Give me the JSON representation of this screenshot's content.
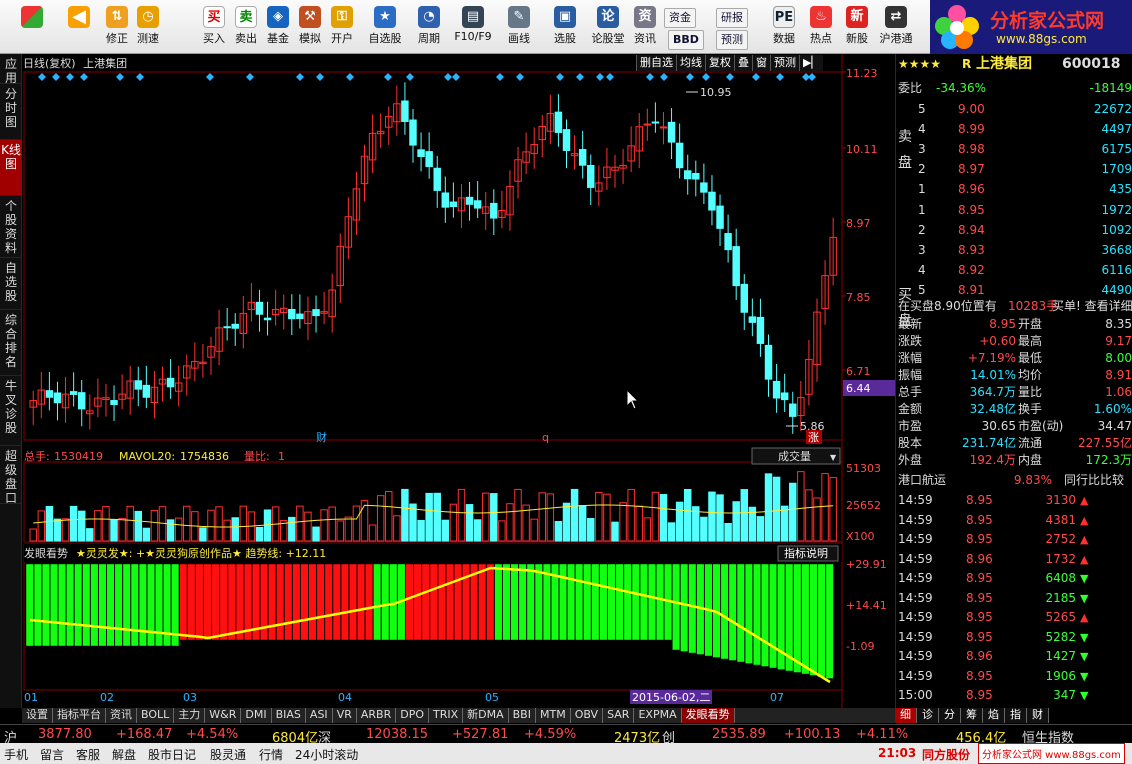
{
  "toolbar": {
    "items": [
      "修正",
      "测速",
      "买入",
      "卖出",
      "基金",
      "模拟",
      "开户",
      "自选股",
      "周期",
      "F10/F9",
      "画线",
      "选股",
      "论股堂",
      "资讯",
      "数据",
      "热点",
      "新股",
      "沪港通"
    ],
    "small": [
      "资金",
      "研报",
      "BBD",
      "预测"
    ]
  },
  "logo": {
    "title": "分析家公式网",
    "url": "www.88gs.com"
  },
  "side_tabs": [
    "应用",
    "分时图",
    "K线图",
    "个股资料",
    "自选股",
    "综合排名",
    "牛叉诊股",
    "超级盘口"
  ],
  "chart": {
    "header_left": "日线(复权)",
    "stock_name": "上港集团",
    "top_buttons": [
      "删自选",
      "均线",
      "复权",
      "叠",
      "窗",
      "预测",
      "▶▏"
    ],
    "price_ticks": [
      "11.23",
      "10.11",
      "8.97",
      "7.85",
      "6.71",
      "6.44"
    ],
    "high_label": "10.95",
    "low_label": "5.86",
    "markers": [
      "财",
      "q",
      "涨"
    ],
    "vol_info": {
      "label": "总手:",
      "value": "1530419",
      "ma_label": "MAVOL20:",
      "ma_value": "1754836",
      "ratio_label": "量比:",
      "ratio": "1"
    },
    "vol_dropdown": "成交量",
    "vol_ticks": [
      "51303",
      "25652",
      "X100"
    ],
    "ind_title": "发眼看势",
    "ind_text": "★灵灵发★: +★灵灵狗原创作品★ 趋势线: +12.11",
    "ind_btn": "指标说明",
    "ind_ticks": [
      "+29.91",
      "+14.41",
      "-1.09"
    ],
    "x_labels": [
      "01",
      "02",
      "03",
      "04",
      "05",
      "07"
    ],
    "cursor_date": "2015-06-02,二"
  },
  "quote": {
    "stars": "★★★★",
    "prefix": "R",
    "name": "上港集团",
    "code": "600018",
    "webi_label": "委比",
    "webi": "-34.36%",
    "webi_diff": "-18149",
    "sell_label": [
      "卖",
      "盘"
    ],
    "buy_label": [
      "买",
      "盘"
    ],
    "sells": [
      {
        "n": "5",
        "p": "9.00",
        "v": "22672"
      },
      {
        "n": "4",
        "p": "8.99",
        "v": "4497"
      },
      {
        "n": "3",
        "p": "8.98",
        "v": "6175"
      },
      {
        "n": "2",
        "p": "8.97",
        "v": "1709"
      },
      {
        "n": "1",
        "p": "8.96",
        "v": "435"
      }
    ],
    "buys": [
      {
        "n": "1",
        "p": "8.95",
        "v": "1972"
      },
      {
        "n": "2",
        "p": "8.94",
        "v": "1092"
      },
      {
        "n": "3",
        "p": "8.93",
        "v": "3668"
      },
      {
        "n": "4",
        "p": "8.92",
        "v": "6116"
      },
      {
        "n": "5",
        "p": "8.91",
        "v": "4490"
      }
    ],
    "notice": "在买盘8.90位置有",
    "notice_num": "10283手",
    "notice_end": "买单! 查看详细",
    "stats": [
      [
        "最新",
        "8.95",
        "开盘",
        "8.35"
      ],
      [
        "涨跌",
        "+0.60",
        "最高",
        "9.17"
      ],
      [
        "涨幅",
        "+7.19%",
        "最低",
        "8.00"
      ],
      [
        "振幅",
        "14.01%",
        "均价",
        "8.91"
      ],
      [
        "总手",
        "364.7万",
        "量比",
        "1.06"
      ],
      [
        "金额",
        "32.48亿",
        "换手",
        "1.60%"
      ],
      [
        "市盈",
        "30.65",
        "市盈(动)",
        "34.47"
      ],
      [
        "股本",
        "231.74亿",
        "流通",
        "227.55亿"
      ],
      [
        "外盘",
        "192.4万",
        "内盘",
        "172.3万"
      ]
    ],
    "sector": "港口航运",
    "sector_pct": "9.83%",
    "sector_btn": "同行比比较",
    "ticks": [
      [
        "14:59",
        "8.95",
        "3130",
        "up"
      ],
      [
        "14:59",
        "8.95",
        "4381",
        "up"
      ],
      [
        "14:59",
        "8.95",
        "2752",
        "up"
      ],
      [
        "14:59",
        "8.96",
        "1732",
        "up"
      ],
      [
        "14:59",
        "8.95",
        "6408",
        "down"
      ],
      [
        "14:59",
        "8.95",
        "2185",
        "down"
      ],
      [
        "14:59",
        "8.95",
        "5265",
        "up"
      ],
      [
        "14:59",
        "8.95",
        "5282",
        "down"
      ],
      [
        "14:59",
        "8.96",
        "1427",
        "down"
      ],
      [
        "14:59",
        "8.95",
        "1906",
        "down"
      ],
      [
        "15:00",
        "8.95",
        "347",
        "down"
      ]
    ]
  },
  "bottom_tabs": [
    "设置",
    "指标平台",
    "资讯",
    "BOLL",
    "主力",
    "W&R",
    "DMI",
    "BIAS",
    "ASI",
    "VR",
    "ARBR",
    "DPO",
    "TRIX",
    "新DMA",
    "BBI",
    "MTM",
    "OBV",
    "SAR",
    "EXPMA",
    "发眼看势"
  ],
  "right_tabs": [
    "细",
    "诊",
    "分",
    "筹",
    "焰",
    "指",
    "财"
  ],
  "ticker": {
    "sh_label": "沪",
    "sh": "3877.80",
    "sh_chg": "+168.47",
    "sh_pct": "+4.54%",
    "sh_amt": "6804亿",
    "sz_label": "深",
    "sz": "12038.15",
    "sz_chg": "+527.81",
    "sz_pct": "+4.59%",
    "sz_amt": "2473亿",
    "cy_label": "创",
    "cy": "2535.89",
    "cy_chg": "+100.13",
    "cy_pct": "+4.11%",
    "hk_amt": "456.4亿",
    "hk_label": "恒生指数"
  },
  "status": {
    "items": [
      "手机",
      "留言",
      "客服",
      "解盘",
      "股市日记",
      "股灵通",
      "行情",
      "24小时滚动"
    ],
    "time": "21:03",
    "broker": "同方股份",
    "watermark": "分析家公式网 www.88gs.com"
  }
}
